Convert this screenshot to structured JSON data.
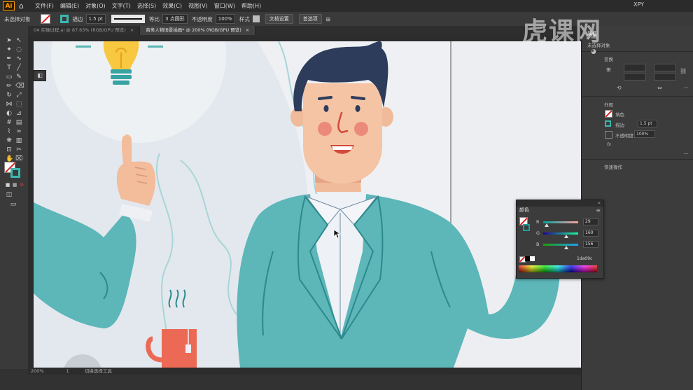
{
  "app": {
    "logo": "Ai",
    "user": "XPY"
  },
  "menu": [
    "文件(F)",
    "编辑(E)",
    "对象(O)",
    "文字(T)",
    "选择(S)",
    "效果(C)",
    "视图(V)",
    "窗口(W)",
    "帮助(H)"
  ],
  "control_bar": {
    "selection": "未选择对象",
    "stroke_label": "描边",
    "stroke_weight": "1.5 pt",
    "stroke_profile": "等比",
    "brush": "3 点圆形",
    "opacity_label": "不透明度",
    "opacity_value": "100%",
    "style_label": "样式",
    "doc_setup": "文档设置",
    "prefs": "首选项"
  },
  "tabs": [
    {
      "label": "04 实操过程.ai @ 87.63% (RGB/GPU 预览)",
      "active": false
    },
    {
      "label": "商务人物场景插画* @ 200% (RGB/GPU 预览)",
      "active": true
    }
  ],
  "status": {
    "zoom": "200%",
    "page": "1",
    "info": "切换选择工具"
  },
  "watermark": "虎课网",
  "right_panel": {
    "title": "属性",
    "subtitle": "未选择对象",
    "transform_label": "变换",
    "appearance_label": "外观",
    "fill_label": "填色",
    "stroke_label": "描边",
    "stroke_value": "1.5 pt",
    "opacity_label": "不透明度",
    "opacity_value": "100%",
    "fx_label": "fx",
    "quick_actions": "快速操作"
  },
  "color_panel": {
    "tab": "颜色",
    "channels": [
      {
        "name": "R",
        "value": "29"
      },
      {
        "name": "G",
        "value": "160"
      },
      {
        "name": "B",
        "value": "156"
      }
    ],
    "hex": "1da09c"
  }
}
